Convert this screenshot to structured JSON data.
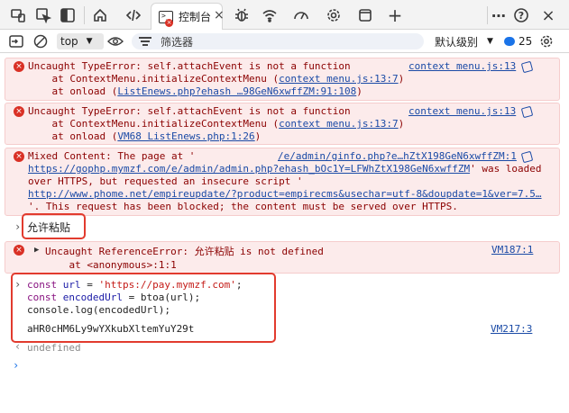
{
  "tabbar": {
    "active_tab_label": "控制台",
    "active_tab_badge": "×",
    "close_glyph": "×",
    "icons": [
      "device-emulation-icon",
      "inspect-icon",
      "dock-icon",
      "home-icon",
      "elements-code-icon",
      "console-tab-icon",
      "bug-icon",
      "wifi-icon",
      "performance-icon",
      "gear-settings-icon",
      "application-icon",
      "plus-icon",
      "more-icon",
      "help-icon",
      "close-icon"
    ],
    "help_glyph": "?",
    "more_glyph": "⋯",
    "window_close_glyph": "×",
    "plus_glyph": "+"
  },
  "toolbar": {
    "context_label": "top",
    "filter_placeholder": "筛选器",
    "level_label": "默认级别",
    "issue_count": "25"
  },
  "console": {
    "messages": [
      {
        "lines": [
          "Uncaught TypeError: self.attachEvent is not a function",
          "    at ContextMenu.initializeContextMenu (",
          "    at onload ("
        ],
        "link1": "context menu.js:13:7",
        "link2": "ListEnews.php?ehash …98GeN6xwffZM:91:108",
        "source": "context menu.js:13",
        "close1": ")",
        "close2": ")"
      },
      {
        "lines": [
          "Uncaught TypeError: self.attachEvent is not a function",
          "    at ContextMenu.initializeContextMenu (",
          "    at onload ("
        ],
        "link1": "context menu.js:13:7",
        "link2": "VM68 ListEnews.php:1:26",
        "source": "context menu.js:13",
        "close1": ")",
        "close2": ")"
      }
    ],
    "mixed": {
      "line1": "Mixed Content: The page at '",
      "link_a": "/e/admin/ginfo.php?e…hZtX198GeN6xwffZM:1",
      "link_b": "https://gophp.mymzf.com/e/admin/admin.php?ehash_bOc1Y=LFWhZtX198GeN6xwffZM",
      "after_b": "' was loaded",
      "line3": "over HTTPS, but requested an insecure script '",
      "link_c": "http://www.phome.net/empireupdate/?product=empirecms&usechar=utf-8&doupdate=1&ver=7.5…",
      "line5": "'. This request has been blocked; the content must be served over HTTPS."
    },
    "input_paste": "允许粘贴",
    "ref_error": {
      "line1": "Uncaught ReferenceError: 允许粘贴 is not defined",
      "line2": "    at <anonymous>:1:1",
      "source": "VM187:1"
    },
    "code": {
      "l1_kw": "const ",
      "l1_var": "url",
      "l1_eq": " = ",
      "l1_str": "'https://pay.mymzf.com'",
      "l1_end": ";",
      "l2_kw": "const ",
      "l2_var": "encodedUrl",
      "l2_rest": " = btoa(url);",
      "l3": "console.log(encodedUrl);"
    },
    "output": "aHR0cHM6Ly9wYXkubXltemYuY29t",
    "output_source": "VM217:3",
    "return_value": "undefined",
    "prompt_glyph": "›",
    "return_glyph": "‹"
  }
}
